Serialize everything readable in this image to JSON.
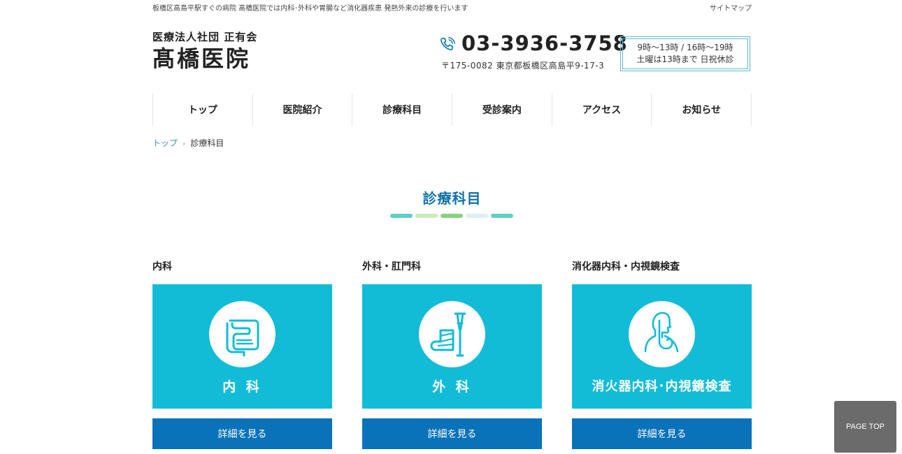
{
  "header": {
    "tagline": "板橋区高島平駅すぐの病院 髙橋医院では内科･外科や胃腸など消化器疾患 発熱外来の診療を行います",
    "sitemap": "サイトマップ",
    "logo_corp": "医療法人社団 正有会",
    "logo_name": "髙橋医院",
    "phone": "03-3936-3758",
    "address": "〒175-0082 東京都板橋区高島平9-17-3",
    "hours_line1": "9時～13時 / 16時～19時",
    "hours_line2": "土曜は13時まで 日祝休診",
    "phone_icon": "phone-icon"
  },
  "nav": {
    "items": [
      "トップ",
      "医院紹介",
      "診療科目",
      "受診案内",
      "アクセス",
      "お知らせ"
    ]
  },
  "breadcrumb": {
    "home": "トップ",
    "separator": "›",
    "current": "診療科目"
  },
  "page": {
    "title": "診療科目",
    "deco_colors": [
      "#5fd0c4",
      "#c8edb9",
      "#86d47e",
      "#daf0f5",
      "#5fd0c4"
    ]
  },
  "cards": [
    {
      "heading": "内科",
      "tile_label": "内 科",
      "icon": "intestine-icon",
      "button": "詳細を見る"
    },
    {
      "heading": "外科・肛門科",
      "tile_label": "外 科",
      "icon": "crutch-cast-icon",
      "button": "詳細を見る"
    },
    {
      "heading": "消化器内科・内視鏡検査",
      "tile_label": "消火器内科･内視鏡検査",
      "icon": "digestive-system-icon",
      "button": "詳細を見る"
    }
  ],
  "colors": {
    "accent_blue": "#0a72b9",
    "tile_cyan": "#12bcd7",
    "title_blue": "#0d72a8"
  },
  "page_top": "PAGE TOP"
}
